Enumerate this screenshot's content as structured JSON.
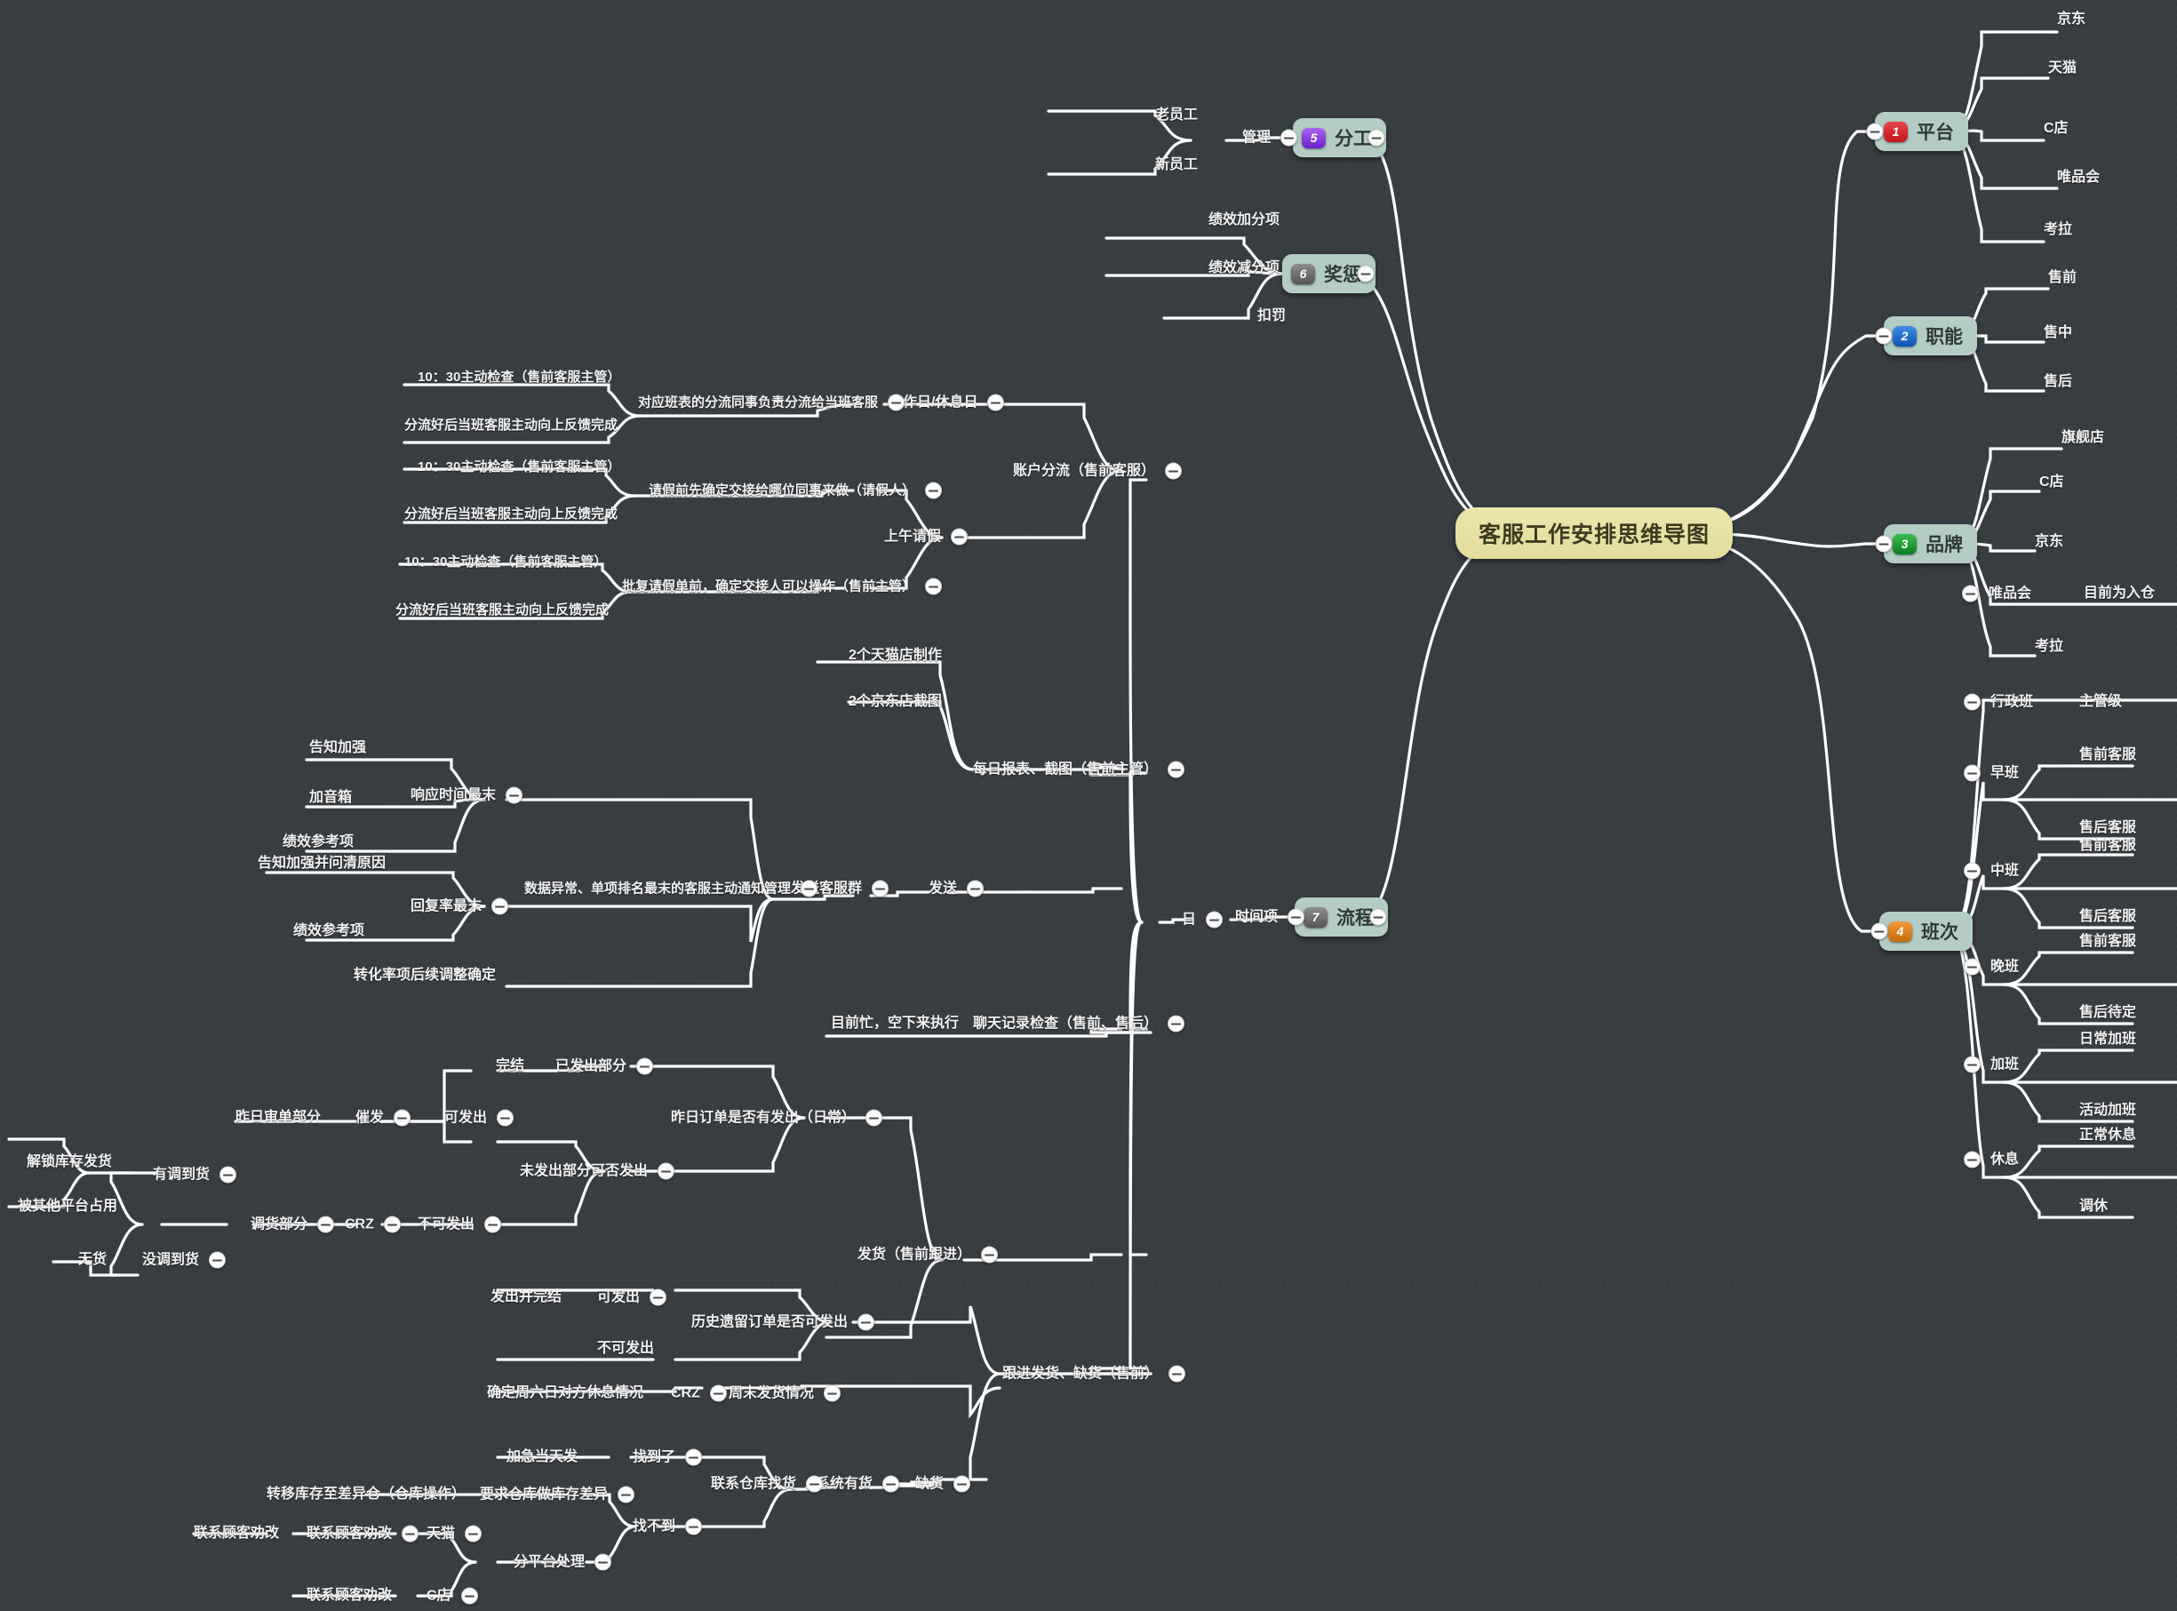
{
  "root": {
    "label": "客服工作安排思维导图",
    "color": "#ece6ac"
  },
  "badges": {
    "1": "#d61f26",
    "2": "#1166cc",
    "3": "#199a32",
    "4": "#d87a18",
    "5": "#8a3ddd",
    "6": "#6f6f6f",
    "7": "#6f6f6f"
  },
  "branches": [
    {
      "num": "1",
      "label": "平台",
      "badge_color": "#d61f26"
    },
    {
      "num": "2",
      "label": "职能",
      "badge_color": "#1166cc"
    },
    {
      "num": "3",
      "label": "品牌",
      "badge_color": "#199a32"
    },
    {
      "num": "4",
      "label": "班次",
      "badge_color": "#d87a18"
    },
    {
      "num": "5",
      "label": "分工",
      "badge_color": "#8a3ddd"
    },
    {
      "num": "6",
      "label": "奖惩",
      "badge_color": "#6f6f6f"
    },
    {
      "num": "7",
      "label": "流程",
      "badge_color": "#6f6f6f"
    }
  ],
  "nodes": {
    "platform_jd": "京东",
    "platform_tmall": "天猫",
    "platform_cshop": "C店",
    "platform_vip": "唯品会",
    "platform_kaola": "考拉",
    "func_pre": "售前",
    "func_mid": "售中",
    "func_post": "售后",
    "brand_flagship": "旗舰店",
    "brand_cshop": "C店",
    "brand_jd": "京东",
    "brand_vip": "唯品会",
    "brand_vip_note": "目前为入仓",
    "brand_kaola": "考拉",
    "shift_admin": "行政班",
    "shift_admin_sub": "主管级",
    "shift_early": "早班",
    "shift_early_pre": "售前客服",
    "shift_early_post": "售后客服",
    "shift_mid": "中班",
    "shift_mid_pre": "售前客服",
    "shift_mid_post": "售后客服",
    "shift_late": "晚班",
    "shift_late_pre": "售前客服",
    "shift_late_post": "售后待定",
    "shift_ot": "加班",
    "shift_ot_daily": "日常加班",
    "shift_ot_event": "活动加班",
    "shift_rest": "休息",
    "shift_rest_normal": "正常休息",
    "shift_rest_swap": "调休",
    "div_manage": "管理",
    "div_old": "老员工",
    "div_new": "新员工",
    "rew_plus": "绩效加分项",
    "rew_minus": "绩效减分项",
    "rew_fine": "扣罚",
    "flow_time": "时间项",
    "flow_day": "日",
    "acct_split": "账户分流（售前客服）",
    "acct_workday": "工作日/休息日",
    "acct_workday_main": "对应班表的分流同事负责分流给当班客服",
    "acct_workday_s1": "10：30主动检查（售前客服主管）",
    "acct_workday_s2": "分流好后当班客服主动向上反馈完成",
    "acct_morning_leave": "上午请假",
    "acct_leave_a": "请假前先确定交接给哪位同事来做（请假人）",
    "acct_leave_a_s1": "10：30主动检查（售前客服主管）",
    "acct_leave_a_s2": "分流好后当班客服主动向上反馈完成",
    "acct_leave_b": "批复请假单前，确定交接人可以操作（售前主管）",
    "acct_leave_b_s1": "10：30主动检查（售前客服主管）",
    "acct_leave_b_s2": "分流好后当班客服主动向上反馈完成",
    "report_main": "每日报表、截图（售前主管）",
    "report_tmall": "2个天猫店制作",
    "report_jd": "2个京东店截图",
    "send_main": "发送",
    "send_group": "发送客服群",
    "abnormal_main": "数据异常、单项排名最末的客服主动通知管理",
    "abn_resp": "响应时间最末",
    "abn_resp_s1": "告知加强",
    "abn_resp_s2": "加音箱",
    "abn_resp_s3": "绩效参考项",
    "abn_reply": "回复率最末",
    "abn_reply_s1": "告知加强并问清原因",
    "abn_reply_s2": "绩效参考项",
    "abn_conv": "转化率项后续调整确定",
    "chat_check": "聊天记录检查（售前、售后）",
    "chat_check_note": "目前忙，空下来执行",
    "ship_main": "发货（售前跟进）",
    "ship_yesterday": "昨日订单是否有发出（日常）",
    "ship_sent_part": "已发出部分",
    "ship_sent_done": "完结",
    "ship_unsent": "未发出部分可否发出",
    "ship_can": "可发出",
    "ship_urge": "催发",
    "ship_yesterday_audit": "昨日审单部分",
    "ship_cannot": "不可发出",
    "ship_crz": "CRZ",
    "ship_transfer": "调货部分",
    "ship_have_arrived": "有调到货",
    "ship_unlock": "解锁库存发货",
    "ship_occupied": "被其他平台占用",
    "ship_not_arrived": "没调到货",
    "ship_no_stock": "无货",
    "follow_main": "跟进发货、缺货（售前）",
    "hist_main": "历史遗留订单是否可发出",
    "hist_can": "可发出",
    "hist_can_note": "发出并完结",
    "hist_cannot": "不可发出",
    "weekend_main": "周末发货情况",
    "weekend_crz": "CRZ",
    "weekend_note": "确定周六日对方休息情况",
    "short_main": "缺货",
    "short_sys": "系统有货",
    "short_warehouse": "联系仓库找货",
    "short_found": "找到了",
    "short_found_note": "加急当天发",
    "short_notfound": "找不到",
    "short_diff": "要求仓库做库存差异",
    "short_diff_note": "转移库存至差异仓（仓库操作）",
    "short_platform": "分平台处理",
    "short_tmall": "天猫",
    "short_tmall_note": "联系顾客劝改",
    "short_tmall_note2": "联系顾客劝改",
    "short_cshop": "C店",
    "short_cshop_note": "联系顾客劝改"
  }
}
